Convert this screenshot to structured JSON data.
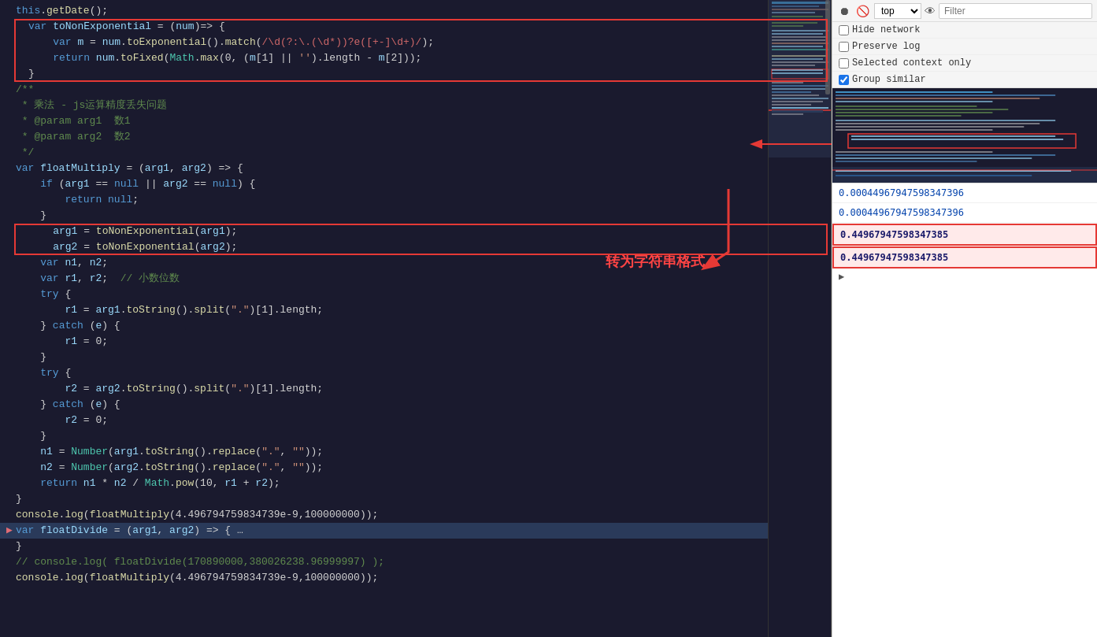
{
  "devtools": {
    "toolbar": {
      "filter_placeholder": "Filter",
      "top_label": "top",
      "buttons": [
        "record",
        "clear",
        "import",
        "export",
        "settings"
      ]
    },
    "options": {
      "hide_network": "Hide network",
      "preserve_log": "Preserve log",
      "selected_context_only": "Selected context only",
      "group_similar": "Group similar",
      "hide_network_checked": false,
      "preserve_log_checked": false,
      "selected_context_only_checked": false,
      "group_similar_checked": true
    },
    "network_entries": [
      {
        "id": 1,
        "url": "0.00044967947598347396",
        "selected": false,
        "highlighted": false
      },
      {
        "id": 2,
        "url": "0.00044967947598347396",
        "selected": false,
        "highlighted": false
      },
      {
        "id": 3,
        "url": "0.44967947598347385",
        "selected": true,
        "highlighted": true
      },
      {
        "id": 4,
        "url": "0.44967947598347385",
        "selected": false,
        "highlighted": true
      }
    ]
  },
  "code": {
    "lines": [
      {
        "num": "",
        "text": "this.getDate();",
        "arrow": false,
        "highlight": false
      },
      {
        "num": "",
        "text": "var toNonExponential = (num)=> {",
        "arrow": false,
        "highlight": false,
        "redbox_top": true
      },
      {
        "num": "",
        "text": "    var m = num.toExponential().match(/\\d(?:.(\\d*))?e([+-]\\d+)/);",
        "arrow": false,
        "highlight": false
      },
      {
        "num": "",
        "text": "    return num.toFixed(Math.max(0, (m[1] || '').length - m[2]));",
        "arrow": false,
        "highlight": false
      },
      {
        "num": "",
        "text": "}",
        "arrow": false,
        "highlight": false,
        "redbox_bot": true
      },
      {
        "num": "",
        "text": "/**",
        "arrow": false,
        "highlight": false
      },
      {
        "num": "",
        "text": " * 乘法 - js运算精度丢失问题",
        "arrow": false,
        "highlight": false
      },
      {
        "num": "",
        "text": " * @param arg1  数1",
        "arrow": false,
        "highlight": false
      },
      {
        "num": "",
        "text": " * @param arg2  数2",
        "arrow": false,
        "highlight": false
      },
      {
        "num": "",
        "text": " */",
        "arrow": false,
        "highlight": false
      },
      {
        "num": "",
        "text": "var floatMultiply = (arg1, arg2) => {",
        "arrow": false,
        "highlight": false
      },
      {
        "num": "",
        "text": "    if (arg1 == null || arg2 == null) {",
        "arrow": false,
        "highlight": false
      },
      {
        "num": "",
        "text": "        return null;",
        "arrow": false,
        "highlight": false
      },
      {
        "num": "",
        "text": "    }",
        "arrow": false,
        "highlight": false
      },
      {
        "num": "",
        "text": "    arg1 = toNonExponential(arg1);",
        "arrow": false,
        "highlight": false,
        "redbox2_top": true
      },
      {
        "num": "",
        "text": "    arg2 = toNonExponential(arg2);",
        "arrow": false,
        "highlight": false,
        "redbox2_bot": true
      },
      {
        "num": "",
        "text": "    var n1, n2;",
        "arrow": false,
        "highlight": false
      },
      {
        "num": "",
        "text": "    var r1, r2;  // 小数位数",
        "arrow": false,
        "highlight": false
      },
      {
        "num": "",
        "text": "    try {",
        "arrow": false,
        "highlight": false
      },
      {
        "num": "",
        "text": "        r1 = arg1.toString().split(\".\")[1].length;",
        "arrow": false,
        "highlight": false
      },
      {
        "num": "",
        "text": "    } catch (e) {",
        "arrow": false,
        "highlight": false
      },
      {
        "num": "",
        "text": "        r1 = 0;",
        "arrow": false,
        "highlight": false
      },
      {
        "num": "",
        "text": "    }",
        "arrow": false,
        "highlight": false
      },
      {
        "num": "",
        "text": "    try {",
        "arrow": false,
        "highlight": false
      },
      {
        "num": "",
        "text": "        r2 = arg2.toString().split(\".\")[1].length;",
        "arrow": false,
        "highlight": false
      },
      {
        "num": "",
        "text": "    } catch (e) {",
        "arrow": false,
        "highlight": false
      },
      {
        "num": "",
        "text": "        r2 = 0;",
        "arrow": false,
        "highlight": false
      },
      {
        "num": "",
        "text": "    }",
        "arrow": false,
        "highlight": false
      },
      {
        "num": "",
        "text": "    n1 = Number(arg1.toString().replace(\".\", \"\"));",
        "arrow": false,
        "highlight": false
      },
      {
        "num": "",
        "text": "    n2 = Number(arg2.toString().replace(\".\", \"\"));",
        "arrow": false,
        "highlight": false
      },
      {
        "num": "",
        "text": "    return n1 * n2 / Math.pow(10, r1 + r2);",
        "arrow": false,
        "highlight": false
      },
      {
        "num": "",
        "text": "}",
        "arrow": false,
        "highlight": false
      },
      {
        "num": "",
        "text": "console.log(floatMultiply(4.496794759834739e-9,100000000));",
        "arrow": false,
        "highlight": false
      },
      {
        "num": "",
        "text": "var floatDivide = (arg1, arg2) => { …",
        "arrow": true,
        "highlight": true
      },
      {
        "num": "",
        "text": "}",
        "arrow": false,
        "highlight": false
      },
      {
        "num": "",
        "text": "// console.log( floatDivide(170890000,380026238.96999997) );",
        "arrow": false,
        "highlight": false
      },
      {
        "num": "",
        "text": "console.log(floatMultiply(4.496794759834739e-9,100000000));",
        "arrow": false,
        "highlight": false
      }
    ],
    "annotation_text": "转为字符串格式"
  }
}
